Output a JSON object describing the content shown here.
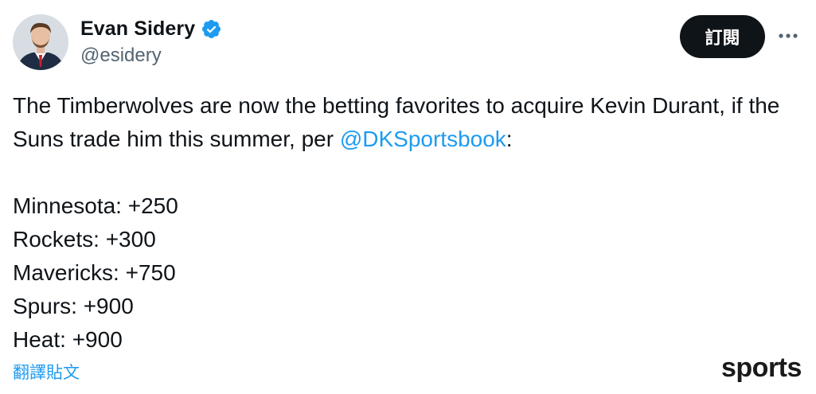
{
  "header": {
    "display_name": "Evan Sidery",
    "handle": "@esidery",
    "verified_icon": "verified-badge-icon",
    "subscribe_label": "訂閱",
    "more_icon": "more-horizontal-icon"
  },
  "tweet": {
    "intro_text": "The Timberwolves are now the betting favorites to acquire Kevin Durant, if the Suns trade him this summer, per ",
    "mention": "@DKSportsbook",
    "intro_suffix": ":",
    "odds": [
      "Minnesota: +250",
      "Rockets: +300",
      "Mavericks: +750",
      "Spurs: +900",
      "Heat: +900"
    ],
    "translate_label": "翻譯貼文"
  },
  "watermark": "sports",
  "colors": {
    "link": "#1d9bf0",
    "text": "#0f1419",
    "secondary": "#536471",
    "button_bg": "#0f1419"
  }
}
